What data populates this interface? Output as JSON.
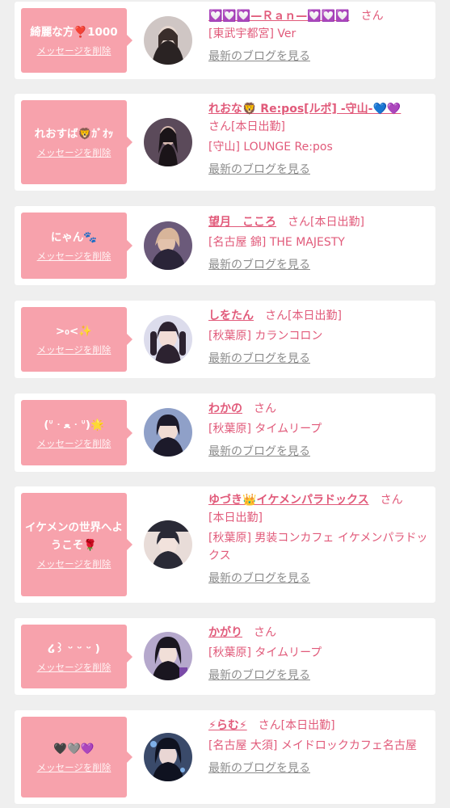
{
  "colors": {
    "page_bg": "#efefef",
    "bubble": "#f7a2ac",
    "name": "#e15a7a",
    "link_gray": "#8c8c8c"
  },
  "items": [
    {
      "message": "綺麗な方❣️1000",
      "delete": "メッセージを削除",
      "name": "💟💟💟—Ｒａｎ—💟💟💟",
      "san": "さん",
      "status": "",
      "shop": "[東武宇都宮] Ver",
      "blog": "最新のブログを見る",
      "avatar_colors": [
        "#cfc6c4",
        "#2a2323"
      ]
    },
    {
      "message": "れおすば🦁ｶﾞｵｯ",
      "delete": "メッセージを削除",
      "name": "れおな🦁 Re:pos[ルポ] -守山-💙💜",
      "san": "さん",
      "status": "[本日出勤]",
      "shop": "[守山] LOUNGE Re:pos",
      "blog": "最新のブログを見る",
      "avatar_colors": [
        "#5b4a5a",
        "#1a1418"
      ]
    },
    {
      "message": "にゃん🐾",
      "delete": "メッセージを削除",
      "name": "望月　こころ",
      "san": "さん",
      "status": "[本日出勤]",
      "shop": "[名古屋 錦] THE MAJESTY",
      "blog": "最新のブログを見る",
      "avatar_colors": [
        "#6b5a7a",
        "#d8b59a"
      ]
    },
    {
      "message": ">₀<✨",
      "delete": "メッセージを削除",
      "name": "しをたん",
      "san": "さん",
      "status": "[本日出勤]",
      "shop": "[秋葉原] カランコロン",
      "blog": "最新のブログを見る",
      "avatar_colors": [
        "#dcdcec",
        "#2c2230"
      ]
    },
    {
      "message": "(ᐡ ᐧ ﻌ ᐧ ᐡ)🌟",
      "delete": "メッセージを削除",
      "name": "わかの",
      "san": "さん",
      "status": "",
      "shop": "[秋葉原] タイムリープ",
      "blog": "最新のブログを見る",
      "avatar_colors": [
        "#8fa0c8",
        "#1c1a2a"
      ]
    },
    {
      "message": "イケメンの世界へようこそ🌹",
      "delete": "メッセージを削除",
      "name": "ゆづき👑イケメンパラドックス",
      "san": "さん",
      "status": "[本日出勤]",
      "shop": "[秋葉原] 男装コンカフェ イケメンパラドックス",
      "blog": "最新のブログを見る",
      "avatar_colors": [
        "#2a2a36",
        "#e8dcd8"
      ]
    },
    {
      "message": "໒꒱ ᵕ ᵕ ᵕ )",
      "delete": "メッセージを削除",
      "name": "かがり",
      "san": "さん",
      "status": "",
      "shop": "[秋葉原] タイムリープ",
      "blog": "最新のブログを見る",
      "avatar_colors": [
        "#b5a8cc",
        "#1a1620"
      ]
    },
    {
      "message": "🖤🩶💜",
      "delete": "メッセージを削除",
      "name": "⚡らむ⚡",
      "san": "さん",
      "status": "[本日出勤]",
      "shop": "[名古屋 大須] メイドロックカフェ名古屋",
      "blog": "最新のブログを見る",
      "avatar_colors": [
        "#3a4a6a",
        "#0f1220"
      ]
    }
  ]
}
